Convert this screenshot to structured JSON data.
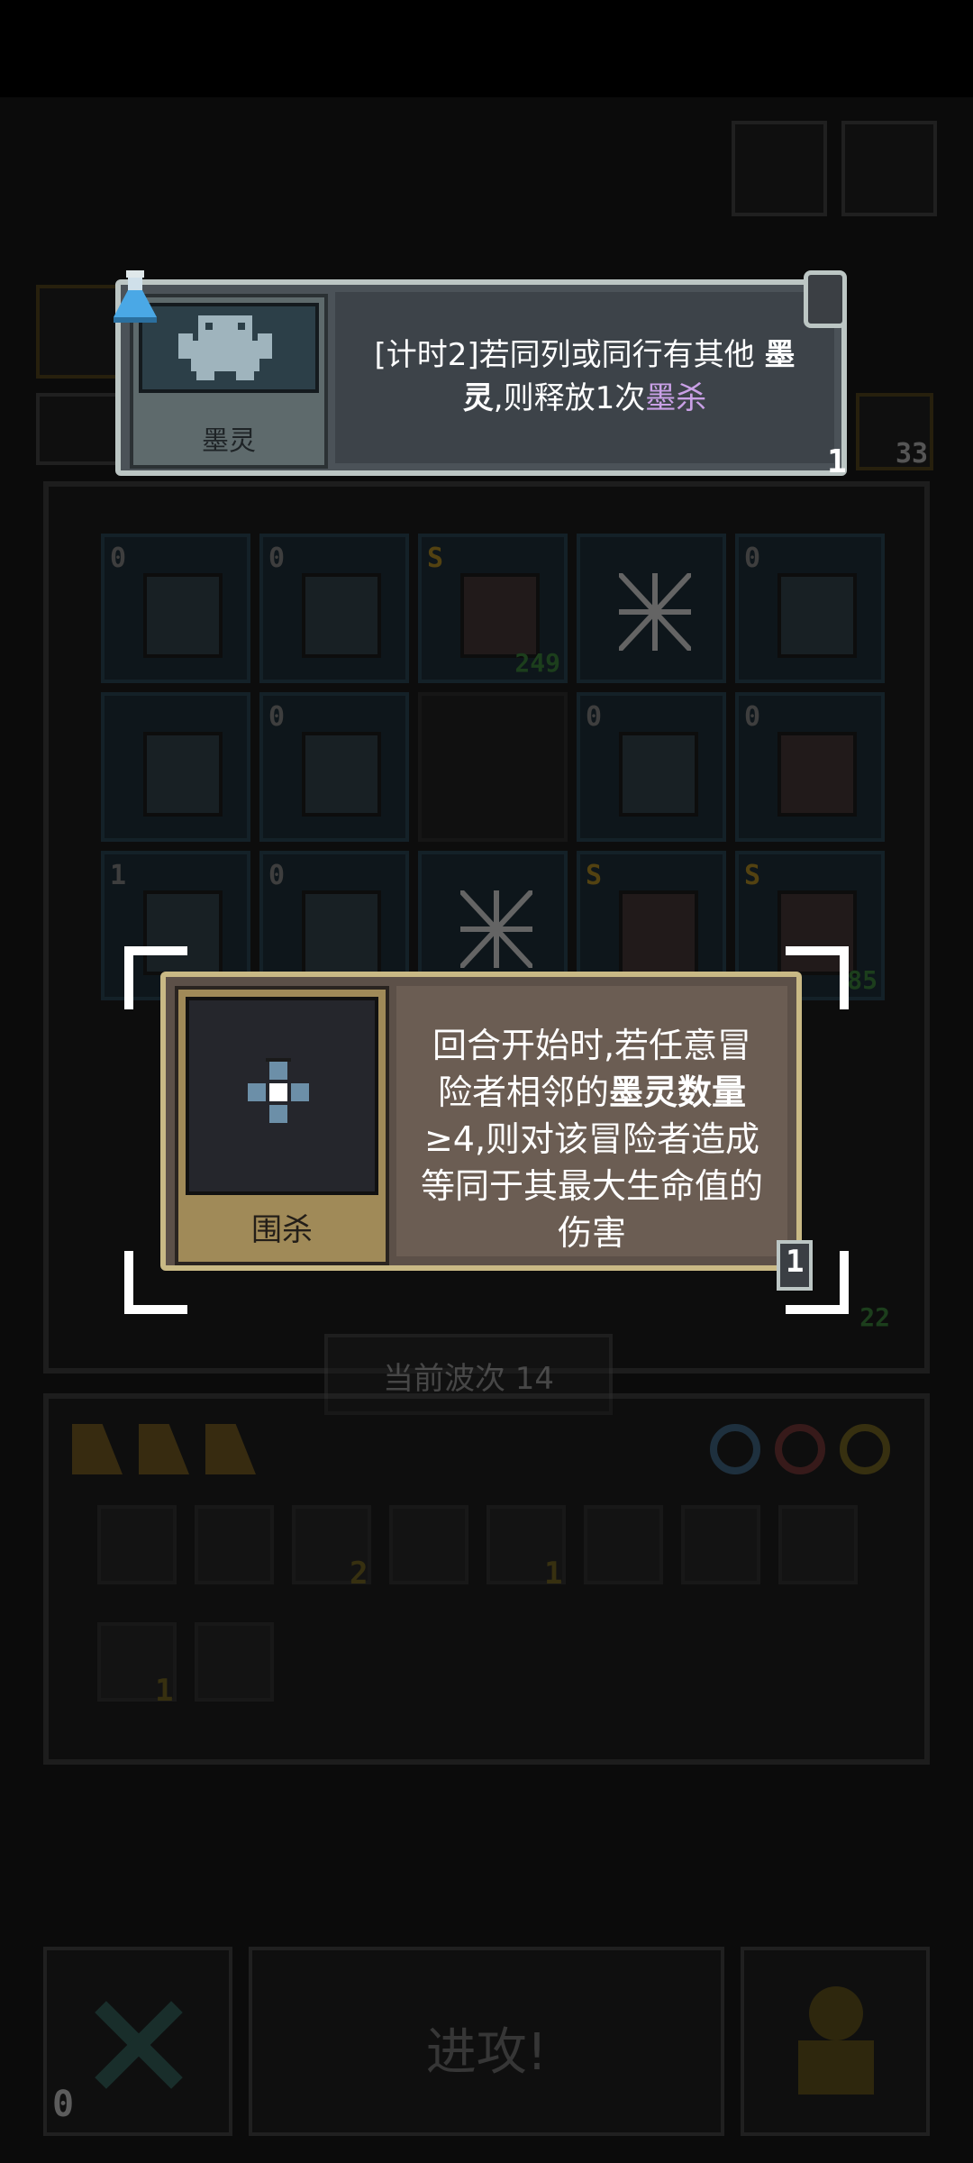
{
  "top_card": {
    "name": "墨灵",
    "desc_prefix": "[计时2]",
    "desc_main": "若同列或同行有其他",
    "desc_bold": "墨灵",
    "desc_mid": ",则释放1次",
    "desc_highlight": "墨杀",
    "count": "1"
  },
  "side_counter": "33",
  "mid_card": {
    "name": "围杀",
    "desc_1": "回合开始时,若任意冒险者相邻的",
    "desc_bold": "墨灵数量",
    "desc_2": "≥4,则对该冒险者造成等同于其最大生命值的伤害",
    "count": "1"
  },
  "board": {
    "cells": [
      {
        "badge": "0",
        "badge_type": "num",
        "hp": "",
        "kind": "ink"
      },
      {
        "badge": "0",
        "badge_type": "num",
        "hp": "",
        "kind": "ink"
      },
      {
        "badge": "S",
        "badge_type": "s",
        "hp": "249",
        "kind": "hero"
      },
      {
        "badge": "",
        "badge_type": "num",
        "hp": "",
        "kind": "web"
      },
      {
        "badge": "0",
        "badge_type": "num",
        "hp": "",
        "kind": "ink"
      },
      {
        "badge": "",
        "badge_type": "num",
        "hp": "",
        "kind": "blob"
      },
      {
        "badge": "0",
        "badge_type": "num",
        "hp": "",
        "kind": "ink"
      },
      {
        "badge": "",
        "badge_type": "num",
        "hp": "",
        "kind": "empty"
      },
      {
        "badge": "0",
        "badge_type": "num",
        "hp": "",
        "kind": "ink"
      },
      {
        "badge": "0",
        "badge_type": "num",
        "hp": "",
        "kind": "hero"
      },
      {
        "badge": "1",
        "badge_type": "num",
        "hp": "",
        "kind": "ink"
      },
      {
        "badge": "0",
        "badge_type": "num",
        "hp": "",
        "kind": "ink"
      },
      {
        "badge": "",
        "badge_type": "num",
        "hp": "",
        "kind": "web"
      },
      {
        "badge": "S",
        "badge_type": "s",
        "hp": "",
        "kind": "hero"
      },
      {
        "badge": "S",
        "badge_type": "s",
        "hp": "85",
        "kind": "hero"
      }
    ],
    "right_edge_hp": "22"
  },
  "wave_label": "当前波次 14",
  "inventory": {
    "items": [
      {
        "icon": "shield-icon",
        "count": ""
      },
      {
        "icon": "hammer-icon",
        "count": ""
      },
      {
        "icon": "sword-icon",
        "count": "2"
      },
      {
        "icon": "wrench-icon",
        "count": ""
      },
      {
        "icon": "cluster-icon",
        "count": "1"
      },
      {
        "icon": "gear-icon",
        "count": ""
      },
      {
        "icon": "scroll-icon",
        "count": ""
      },
      {
        "icon": "ship-icon",
        "count": ""
      },
      {
        "icon": "crystal-icon",
        "count": "1"
      },
      {
        "icon": "mallet-icon",
        "count": ""
      }
    ]
  },
  "bottom": {
    "attack_label": "进攻!",
    "cancel_count": "0"
  },
  "colors": {
    "top_card_border": "#bcc6c4",
    "mid_card_border": "#c9b985",
    "highlight": "#c9a0e6",
    "hp_green": "#2f7a2f"
  }
}
